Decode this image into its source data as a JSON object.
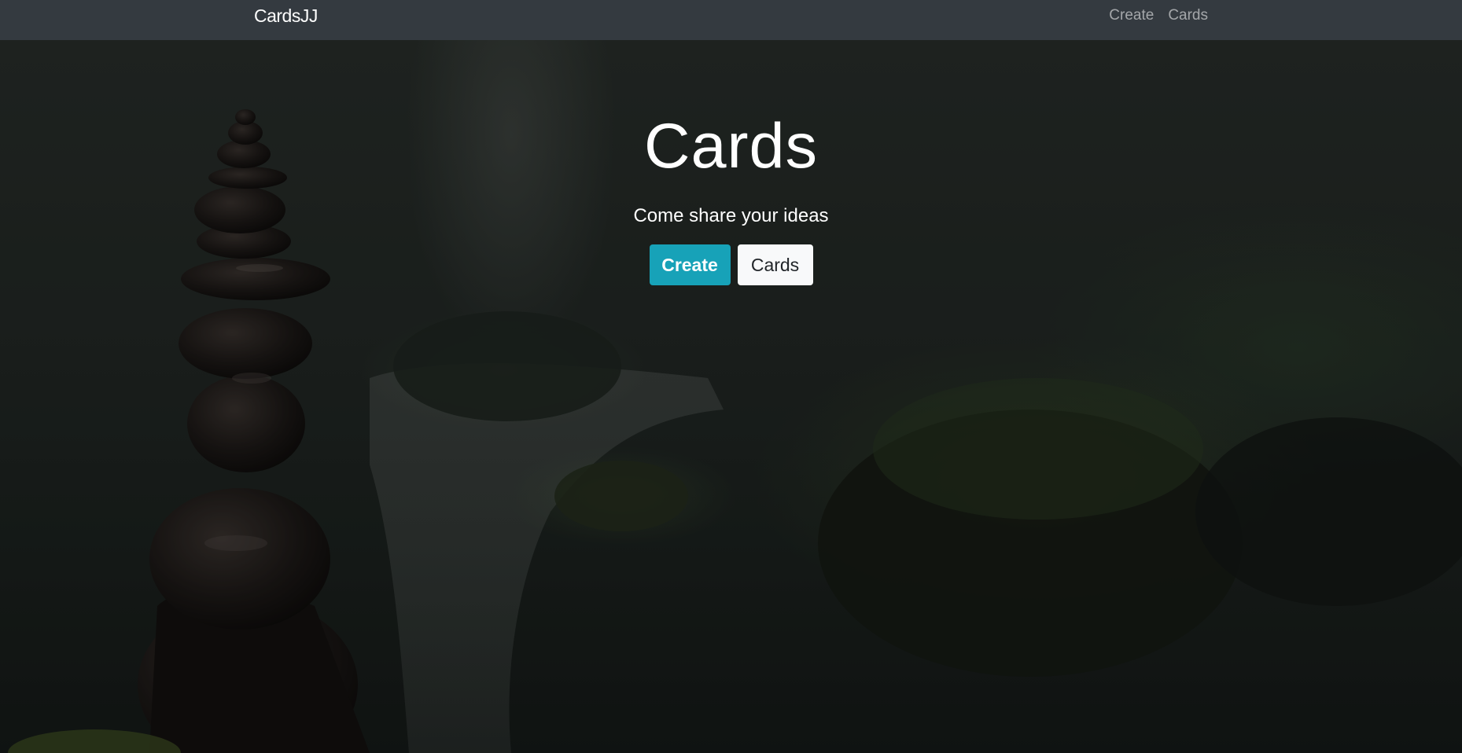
{
  "navbar": {
    "brand": "CardsJJ",
    "links": [
      {
        "label": "Create"
      },
      {
        "label": "Cards"
      }
    ]
  },
  "hero": {
    "title": "Cards",
    "subtitle": "Come share your ideas",
    "buttons": [
      {
        "label": "Create",
        "style": "primary"
      },
      {
        "label": "Cards",
        "style": "light"
      }
    ],
    "background": "stacked-stones-waterfall-photo"
  },
  "colors": {
    "navbar_bg": "#343a40",
    "primary_button": "#17a2b8",
    "light_button": "#f8f9fa"
  }
}
